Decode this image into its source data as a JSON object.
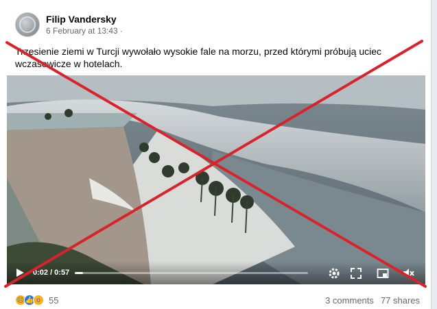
{
  "post": {
    "author": "Filip Vandersky",
    "date": "6 February at 13:43 ·",
    "text": "Trzęsienie ziemi w Turcji wywołało wysokie fale na morzu, przed którymi próbują uciec wczasowicze w hotelach."
  },
  "video": {
    "time": "0:02 / 0:57",
    "progress": 0.035,
    "icons": [
      "play-icon",
      "settings-icon",
      "fullscreen-icon",
      "picture-in-picture-icon",
      "mute-icon"
    ]
  },
  "overlay": {
    "cross_color": "#d8232a"
  },
  "footer": {
    "reaction_icons": [
      "sad",
      "like",
      "wow"
    ],
    "reaction_count": "55",
    "comments": "3 comments",
    "shares": "77 shares"
  }
}
